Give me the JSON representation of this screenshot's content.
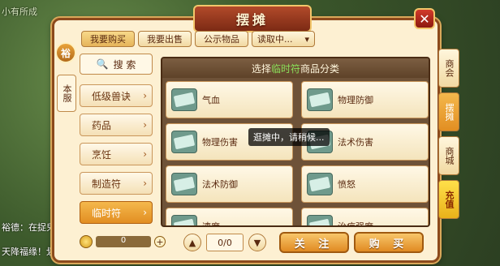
{
  "background": {
    "top_left_text": "小有所成",
    "chat_line_1": "裕德：在捉鬼的时",
    "chat_line_2": "天降福缘！划 "
  },
  "window": {
    "title": "摆摊",
    "close_icon": "close-icon"
  },
  "tabs": [
    {
      "label": "我要购买",
      "active": true
    },
    {
      "label": "我要出售",
      "active": false
    },
    {
      "label": "公示物品",
      "active": false
    }
  ],
  "read_select": {
    "label": "读取中...",
    "arrow": "▾"
  },
  "server_badge": "裕",
  "server_label": "本服",
  "search": {
    "label": "搜 索",
    "icon": "search-icon"
  },
  "categories": [
    {
      "label": "低级兽诀",
      "active": false
    },
    {
      "label": "药品",
      "active": false
    },
    {
      "label": "烹饪",
      "active": false
    },
    {
      "label": "制造符",
      "active": false
    },
    {
      "label": "临时符",
      "active": true
    }
  ],
  "content": {
    "header_prefix": "选择",
    "header_highlight": "临时符",
    "header_suffix": "商品分类",
    "items": [
      "气血",
      "物理防御",
      "物理伤害",
      "法术伤害",
      "法术防御",
      "愤怒",
      "速度",
      "治疗强度"
    ]
  },
  "toast": "逛摊中，请稍候...",
  "coins": {
    "value": "0",
    "plus": "+"
  },
  "pagination": {
    "up": "▲",
    "down": "▼",
    "page": "0/0"
  },
  "buttons": {
    "follow": "关 注",
    "buy": "购 买"
  },
  "side_tabs": [
    {
      "label": "商会",
      "style": "normal"
    },
    {
      "label": "摆摊",
      "style": "active"
    },
    {
      "label": "商城",
      "style": "normal"
    },
    {
      "label": "充值",
      "style": "charge"
    }
  ]
}
